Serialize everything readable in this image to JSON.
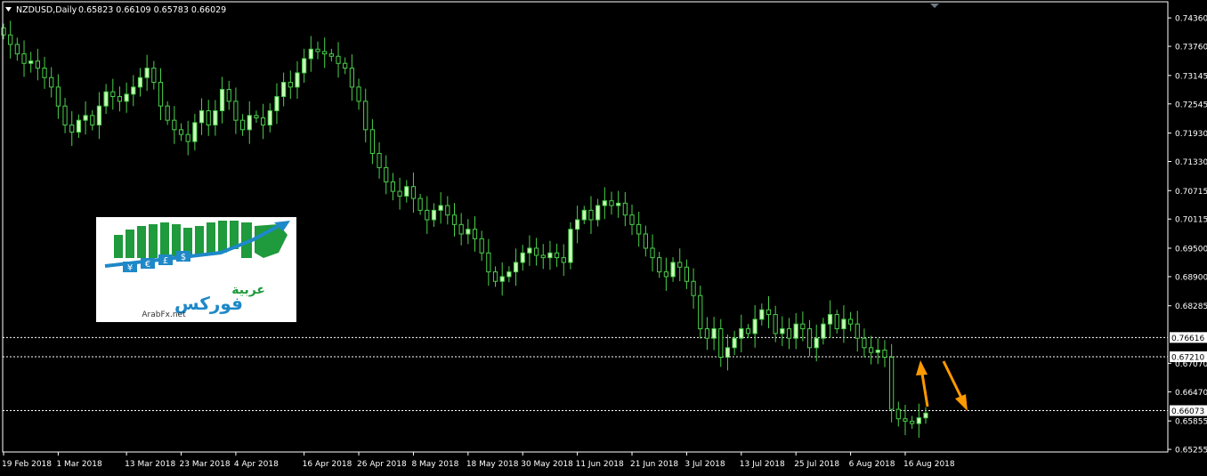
{
  "header": {
    "symbol": "NZDUSD,Daily",
    "ohlc": "0.65823 0.66109 0.65783 0.66029"
  },
  "logo": {
    "arabic_top": "عربية",
    "arabic_main": "فوركس",
    "site": "ArabFx.net",
    "currency_symbols": [
      "¥",
      "€",
      "£",
      "$"
    ]
  },
  "price_labels": {
    "l1": "0.76616",
    "l2": "0.67210",
    "l3": "0.66073"
  },
  "colors": {
    "background": "#000000",
    "bull_candle": "#c8ffb8",
    "bear_candle": "#000000",
    "candle_outline": "#4ad04a",
    "axis": "#ffffff",
    "arrow": "#ff9900",
    "logo_green": "#1f9a3c",
    "logo_blue": "#1e88c8"
  },
  "chart_data": {
    "type": "candlestick",
    "ylim": [
      0.652,
      0.747
    ],
    "y_ticks": [
      "0.74360",
      "0.73760",
      "0.73145",
      "0.72545",
      "0.71930",
      "0.71330",
      "0.70715",
      "0.70115",
      "0.69500",
      "0.68900",
      "0.68285",
      "0.67070",
      "0.66470",
      "0.65855",
      "0.65255"
    ],
    "y_tick_values": [
      0.7436,
      0.7376,
      0.73145,
      0.72545,
      0.7193,
      0.7133,
      0.70715,
      0.70115,
      0.695,
      0.689,
      0.68285,
      0.6707,
      0.6647,
      0.65855,
      0.65255
    ],
    "x_labels": [
      "19 Feb 2018",
      "1 Mar 2018",
      "13 Mar 2018",
      "23 Mar 2018",
      "4 Apr 2018",
      "16 Apr 2018",
      "26 Apr 2018",
      "8 May 2018",
      "18 May 2018",
      "30 May 2018",
      "11 Jun 2018",
      "21 Jun 2018",
      "3 Jul 2018",
      "13 Jul 2018",
      "25 Jul 2018",
      "6 Aug 2018",
      "16 Aug 2018"
    ],
    "x_label_index": [
      0,
      8,
      18,
      26,
      34,
      44,
      52,
      60,
      68,
      76,
      84,
      92,
      100,
      108,
      116,
      124,
      132
    ],
    "horizontal_lines": [
      0.67616,
      0.6721,
      0.66073
    ],
    "close_series": [
      0.74,
      0.738,
      0.736,
      0.734,
      0.7345,
      0.733,
      0.731,
      0.729,
      0.725,
      0.721,
      0.7195,
      0.722,
      0.723,
      0.721,
      0.725,
      0.728,
      0.727,
      0.726,
      0.7275,
      0.729,
      0.731,
      0.733,
      0.73,
      0.725,
      0.722,
      0.72,
      0.719,
      0.7175,
      0.7215,
      0.724,
      0.721,
      0.724,
      0.7285,
      0.726,
      0.722,
      0.72,
      0.723,
      0.7225,
      0.721,
      0.724,
      0.727,
      0.73,
      0.729,
      0.732,
      0.735,
      0.737,
      0.7365,
      0.736,
      0.7355,
      0.734,
      0.733,
      0.729,
      0.726,
      0.72,
      0.715,
      0.712,
      0.709,
      0.707,
      0.706,
      0.708,
      0.7055,
      0.703,
      0.701,
      0.703,
      0.704,
      0.702,
      0.7,
      0.698,
      0.699,
      0.697,
      0.694,
      0.69,
      0.688,
      0.689,
      0.69,
      0.692,
      0.694,
      0.695,
      0.6935,
      0.693,
      0.694,
      0.693,
      0.692,
      0.699,
      0.701,
      0.703,
      0.701,
      0.704,
      0.705,
      0.704,
      0.7045,
      0.702,
      0.7,
      0.698,
      0.695,
      0.693,
      0.69,
      0.689,
      0.692,
      0.691,
      0.688,
      0.685,
      0.678,
      0.676,
      0.678,
      0.672,
      0.674,
      0.676,
      0.678,
      0.677,
      0.68,
      0.682,
      0.681,
      0.677,
      0.678,
      0.676,
      0.679,
      0.678,
      0.674,
      0.676,
      0.679,
      0.681,
      0.678,
      0.68,
      0.679,
      0.676,
      0.674,
      0.673,
      0.6735,
      0.672,
      0.661,
      0.659,
      0.6585,
      0.658,
      0.6592,
      0.6602
    ]
  }
}
